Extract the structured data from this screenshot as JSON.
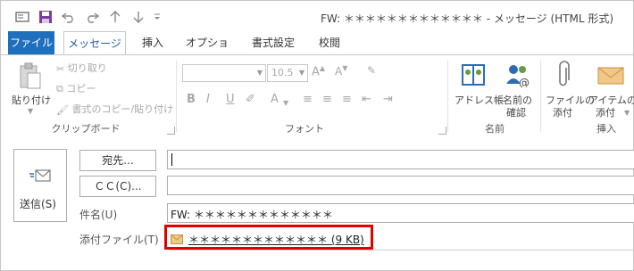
{
  "window": {
    "title": "FW: ＊＊＊＊＊＊＊＊＊＊＊＊＊ - メッセージ (HTML 形式)"
  },
  "quick_access": [
    {
      "icon": "message-window-icon"
    },
    {
      "icon": "save-icon"
    },
    {
      "icon": "undo-icon"
    },
    {
      "icon": "redo-icon"
    },
    {
      "icon": "up-arrow-icon"
    },
    {
      "icon": "down-arrow-icon"
    },
    {
      "icon": "customize-icon"
    }
  ],
  "tabs": {
    "file": "ファイル",
    "message": "メッセージ",
    "insert": "挿入",
    "options": "オプション",
    "format": "書式設定",
    "review": "校閲"
  },
  "ribbon": {
    "clipboard": {
      "paste": "貼り付け",
      "cut": "切り取り",
      "copy": "コピー",
      "format_painter": "書式のコピー/貼り付け",
      "label": "クリップボード"
    },
    "font": {
      "font_size": "10.5",
      "bold": "B",
      "italic": "I",
      "underline": "U",
      "label": "フォント"
    },
    "names": {
      "address_book": "アドレス帳",
      "check_names_1": "名前の",
      "check_names_2": "確認",
      "label": "名前"
    },
    "insert": {
      "attach_file_1": "ファイルの",
      "attach_file_2": "添付",
      "attach_item_1": "アイテムの",
      "attach_item_2": "添付",
      "label": "挿入"
    }
  },
  "compose": {
    "send_label": "送信(S)",
    "to_button": "宛先...",
    "cc_button": "ＣＣ(C)...",
    "subject_label": "件名(U)",
    "subject_value": "FW: ＊＊＊＊＊＊＊＊＊＊＊＊＊",
    "attachments_label": "添付ファイル(T)",
    "attachment_name": "＊＊＊＊＊＊＊＊＊＊＊＊＊ (9 KB)"
  },
  "colors": {
    "file_tab": "#1f6fbf",
    "active_tab_text": "#1f5fa6",
    "highlight": "#e00000"
  }
}
